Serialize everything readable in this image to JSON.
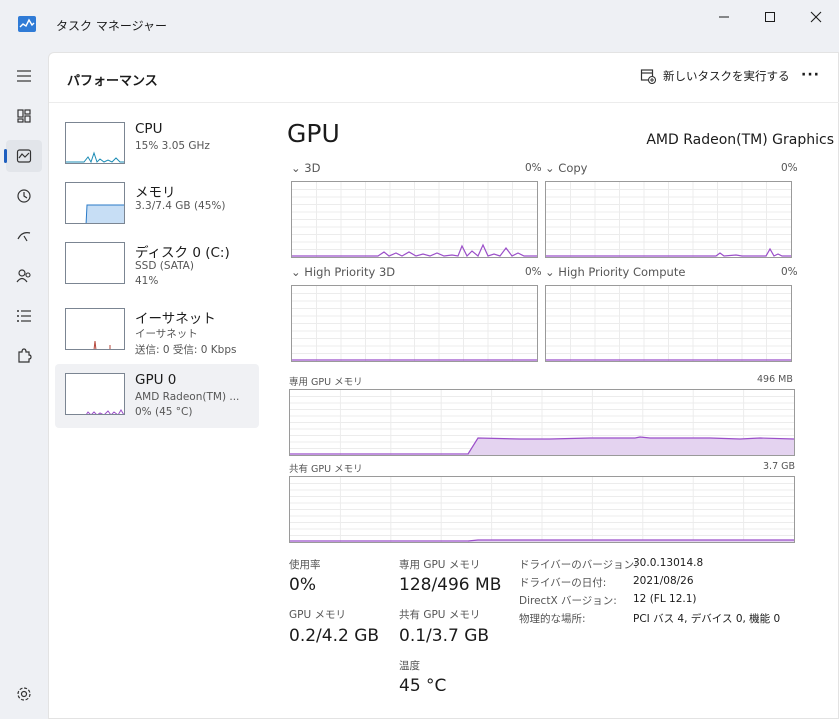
{
  "window": {
    "title": "タスク マネージャー",
    "icon": "task-manager-icon"
  },
  "header": {
    "title": "パフォーマンス",
    "run_task_label": "新しいタスクを実行する",
    "more_label": "···"
  },
  "devices": [
    {
      "name": "CPU",
      "sub1": "15%  3.05 GHz",
      "sub2": ""
    },
    {
      "name": "メモリ",
      "sub1": "3.3/7.4 GB (45%)",
      "sub2": ""
    },
    {
      "name": "ディスク 0 (C:)",
      "sub1": "SSD (SATA)",
      "sub2": "41%"
    },
    {
      "name": "イーサネット",
      "sub1": "イーサネット",
      "sub2": "送信: 0 受信: 0 Kbps"
    },
    {
      "name": "GPU 0",
      "sub1": "AMD Radeon(TM) ...",
      "sub2": "0% (45 °C)"
    }
  ],
  "gpu": {
    "title": "GPU",
    "model": "AMD Radeon(TM) Graphics",
    "engines": [
      {
        "label": "3D",
        "pct": "0%"
      },
      {
        "label": "Copy",
        "pct": "0%"
      },
      {
        "label": "High Priority 3D",
        "pct": "0%"
      },
      {
        "label": "High Priority Compute",
        "pct": "0%"
      }
    ],
    "dedicated_label": "専用 GPU メモリ",
    "dedicated_max": "496 MB",
    "shared_label": "共有 GPU メモリ",
    "shared_max": "3.7 GB"
  },
  "stats": {
    "usage_label": "使用率",
    "usage_value": "0%",
    "dedicated_label": "専用 GPU メモリ",
    "dedicated_value": "128/496 MB",
    "gpu_mem_label": "GPU メモリ",
    "gpu_mem_value": "0.2/4.2 GB",
    "shared_label": "共有 GPU メモリ",
    "shared_value": "0.1/3.7 GB",
    "temp_label": "温度",
    "temp_value": "45 °C"
  },
  "info": [
    {
      "key": "ドライバーのバージョン:",
      "value": "30.0.13014.8"
    },
    {
      "key": "ドライバーの日付:",
      "value": "2021/08/26"
    },
    {
      "key": "DirectX バージョン:",
      "value": "12 (FL 12.1)"
    },
    {
      "key": "物理的な場所:",
      "value": "PCI バス 4, デバイス 0, 機能 0"
    }
  ],
  "colors": {
    "gpu_line": "#9b4fc9",
    "gpu_fill": "#e4d3f0",
    "cpu_line": "#1c8cb5",
    "mem_fill": "#c7def5",
    "mem_line": "#2a7ac7",
    "eth_line": "#b5473b",
    "accent": "#1f5fbf"
  }
}
